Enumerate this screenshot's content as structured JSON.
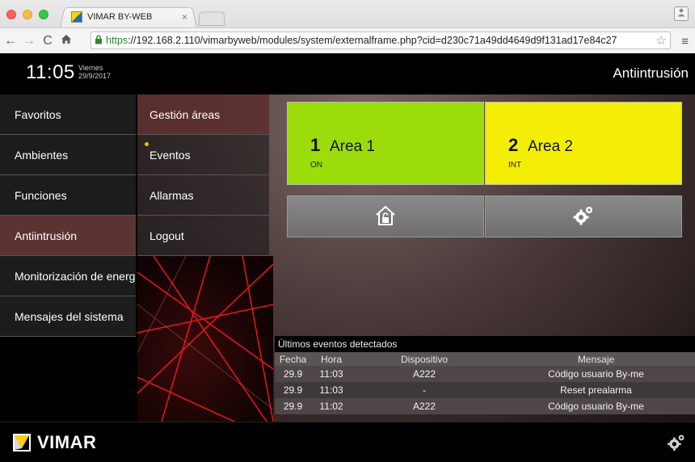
{
  "browser": {
    "tab_title": "VIMAR BY-WEB",
    "tab_close": "×",
    "url_https": "https",
    "url_rest": "://192.168.2.110/vimarbyweb/modules/system/externalframe.php?cid=d230c71a49dd4649d9f131ad17e84c27",
    "icons": [
      "back-icon",
      "forward-icon",
      "reload-icon",
      "home-icon",
      "lock-icon",
      "star-icon",
      "menu-icon"
    ]
  },
  "header": {
    "time": "11:05",
    "weekday": "Viernes",
    "date": "29/9/2017",
    "title": "Antiintrusión"
  },
  "menu_main": [
    {
      "label": "Favoritos"
    },
    {
      "label": "Ambientes"
    },
    {
      "label": "Funciones"
    },
    {
      "label": "Antiintrusión"
    },
    {
      "label": "Monitorización de energía"
    },
    {
      "label": "Mensajes del sistema"
    }
  ],
  "menu_sub": [
    {
      "label": "Gestión áreas"
    },
    {
      "label": "Eventos"
    },
    {
      "label": "Allarmas"
    },
    {
      "label": "Logout"
    }
  ],
  "areas": [
    {
      "number": "1",
      "name": "Area 1",
      "state": "ON",
      "color": "#9bdc0a"
    },
    {
      "number": "2",
      "name": "Area 2",
      "state": "INT",
      "color": "#f4ee07"
    }
  ],
  "actions": [
    "house-lock-icon",
    "gears-icon"
  ],
  "events": {
    "title": "Últimos eventos detectados",
    "columns": [
      "Fecha",
      "Hora",
      "Dispositivo",
      "Mensaje"
    ],
    "rows": [
      [
        "29.9",
        "11:03",
        "A222",
        "Código usuario By-me"
      ],
      [
        "29.9",
        "11:03",
        "-",
        "Reset prealarma"
      ],
      [
        "29.9",
        "11:02",
        "A222",
        "Código usuario By-me"
      ]
    ]
  },
  "footer": {
    "brand": "VIMAR"
  }
}
